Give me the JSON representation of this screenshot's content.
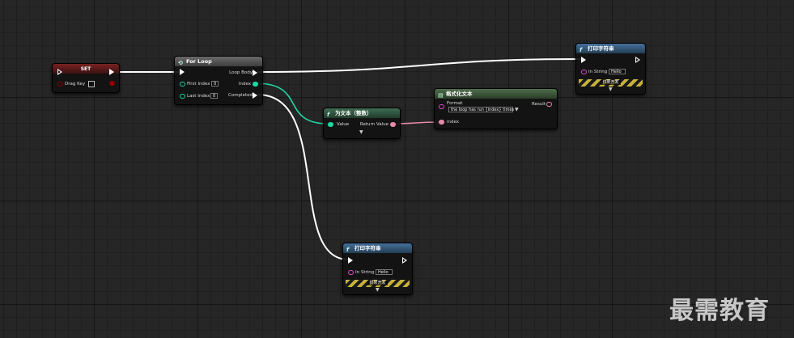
{
  "colors": {
    "exec": "#ffffff",
    "integer": "#1fd7a3",
    "string": "#e24ad3",
    "boolean": "#8f0000",
    "set_header": "#5a1a1a",
    "for_header": "#4b4b4b",
    "func_header": "#2f5578",
    "conv_header": "#2e5540",
    "text_header": "#3d5a3a"
  },
  "set_node": {
    "title": "SET",
    "var_label": "Drag Key"
  },
  "for_loop": {
    "title": "For Loop",
    "icon": "loop-icon",
    "first_index_label": "First Index",
    "first_index_value": "0",
    "last_index_label": "Last Index",
    "last_index_value": "0",
    "loop_body_label": "Loop Body",
    "index_label": "Index",
    "completed_label": "Completed"
  },
  "to_text": {
    "title": "为文本（整数）",
    "icon": "f",
    "value_label": "Value",
    "return_label": "Return Value"
  },
  "format_text": {
    "title": "格式化文本",
    "icon": "text-format-icon",
    "format_label": "Format",
    "format_value": "the loop has run {index} times",
    "result_label": "Result",
    "index_label": "index"
  },
  "print_top": {
    "title": "打印字符串",
    "icon": "f",
    "in_string_label": "In String",
    "in_string_value": "Hello",
    "dev_only": "仅限开发"
  },
  "print_bottom": {
    "title": "打印字符串",
    "icon": "f",
    "in_string_label": "In String",
    "in_string_value": "Hello",
    "dev_only": "仅限开发"
  },
  "watermark": "最需教育"
}
